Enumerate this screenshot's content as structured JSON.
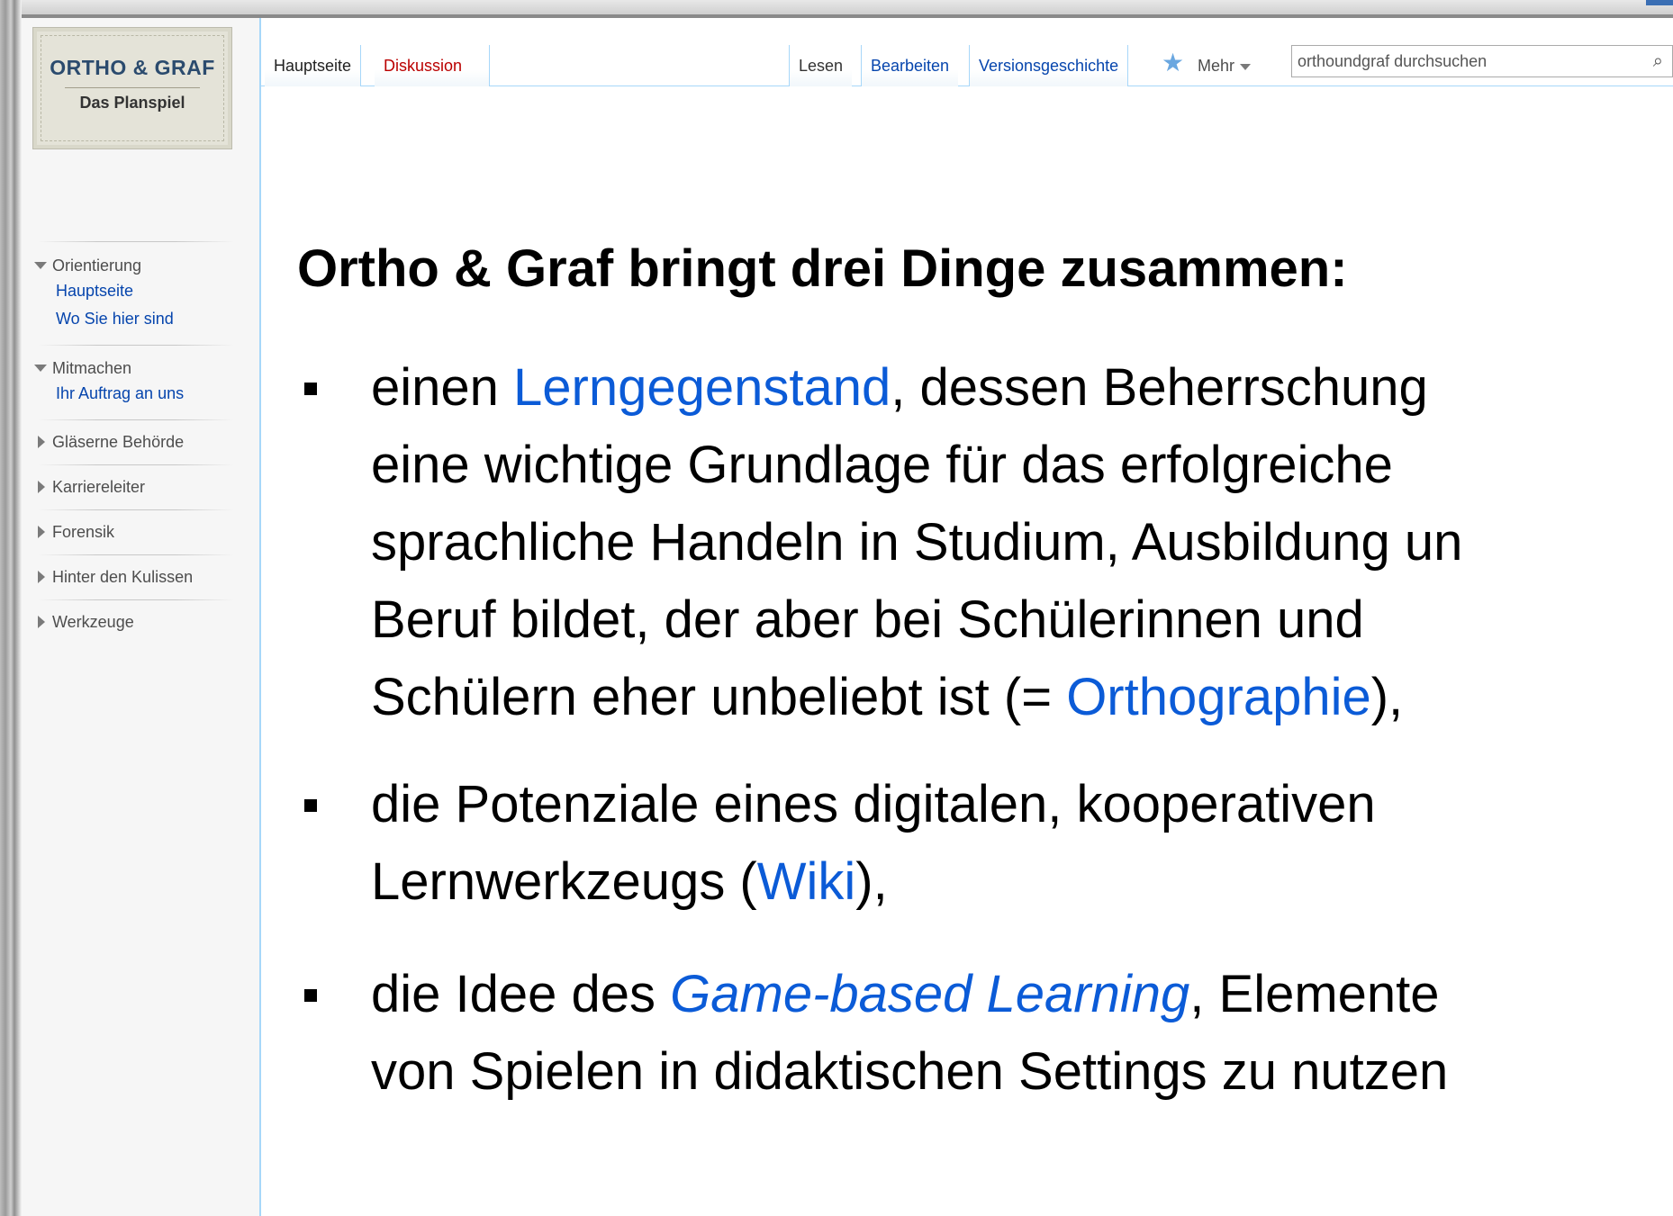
{
  "logo": {
    "title": "ORTHO & GRAF",
    "subtitle": "Das Planspiel"
  },
  "sidebar": {
    "sections": [
      {
        "label": "Orientierung",
        "expanded": true,
        "items": [
          "Hauptseite",
          "Wo Sie hier sind"
        ]
      },
      {
        "label": "Mitmachen",
        "expanded": true,
        "items": [
          "Ihr Auftrag an uns"
        ]
      },
      {
        "label": "Gläserne Behörde",
        "expanded": false
      },
      {
        "label": "Karriereleiter",
        "expanded": false
      },
      {
        "label": "Forensik",
        "expanded": false
      },
      {
        "label": "Hinter den Kulissen",
        "expanded": false
      },
      {
        "label": "Werkzeuge",
        "expanded": false
      }
    ]
  },
  "tabs": {
    "left": [
      "Hauptseite",
      "Diskussion"
    ],
    "right": [
      "Lesen",
      "Bearbeiten",
      "Versionsgeschichte"
    ],
    "more": "Mehr"
  },
  "search": {
    "placeholder": "orthoundgraf durchsuchen"
  },
  "icons": {
    "watch": "star-icon",
    "search": "magnifier-icon"
  },
  "colors": {
    "link": "#0645ad",
    "accent_link": "#0b5bd7",
    "tab_border": "#a7d7f9",
    "new_link": "#ba0000"
  },
  "content": {
    "headline": "Ortho & Graf bringt drei Dinge zusammen:",
    "b1": {
      "l1_pre": "einen ",
      "l1_link": "Lerngegenstand",
      "l1_post": ", dessen Beherrschung",
      "l2": "eine wichtige Grundlage für das erfolgreiche",
      "l3": "sprachliche Handeln in Studium, Ausbildung un",
      "l4": "Beruf bildet, der aber bei Schülerinnen und",
      "l5_pre": "Schülern eher unbeliebt ist (= ",
      "l5_link": "Orthographie",
      "l5_post": "),"
    },
    "b2": {
      "l1": "die Potenziale eines digitalen, kooperativen",
      "l2_pre": "Lernwerkzeugs (",
      "l2_link": "Wiki",
      "l2_post": "),"
    },
    "b3": {
      "l1_pre": "die Idee des ",
      "l1_link": "Game-based Learning",
      "l1_post": ", Elemente",
      "l2": "von Spielen in didaktischen Settings zu nutzen"
    }
  }
}
